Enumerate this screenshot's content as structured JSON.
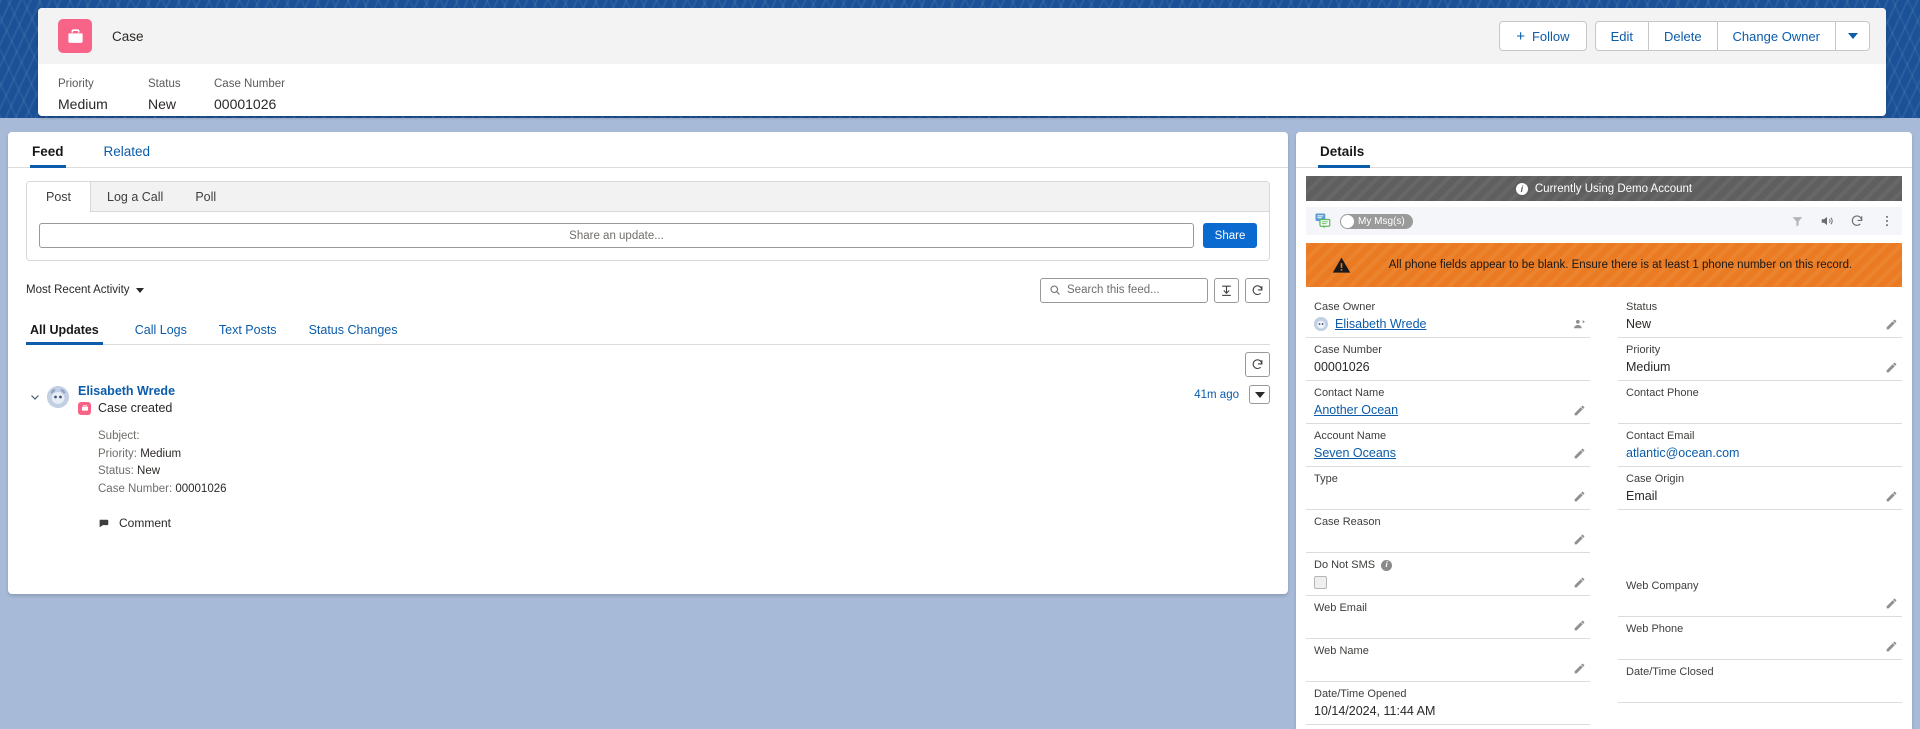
{
  "header": {
    "object_icon": "briefcase-icon",
    "object_label": "Case",
    "fields": [
      {
        "label": "Priority",
        "value": "Medium"
      },
      {
        "label": "Status",
        "value": "New"
      },
      {
        "label": "Case Number",
        "value": "00001026"
      }
    ],
    "actions": {
      "follow": "Follow",
      "edit": "Edit",
      "delete": "Delete",
      "change_owner": "Change Owner"
    }
  },
  "feed": {
    "tabs": [
      {
        "label": "Feed",
        "active": true
      },
      {
        "label": "Related",
        "active": false
      }
    ],
    "publisher": {
      "tabs": [
        {
          "label": "Post",
          "active": true
        },
        {
          "label": "Log a Call",
          "active": false
        },
        {
          "label": "Poll",
          "active": false
        }
      ],
      "input_placeholder": "Share an update...",
      "share_label": "Share"
    },
    "controls": {
      "sort_label": "Most Recent Activity",
      "search_placeholder": "Search this feed...",
      "sort_icon": "sort-icon",
      "refresh_icon": "refresh-icon"
    },
    "subtabs": [
      {
        "label": "All Updates",
        "active": true
      },
      {
        "label": "Call Logs",
        "active": false
      },
      {
        "label": "Text Posts",
        "active": false
      },
      {
        "label": "Status Changes",
        "active": false
      }
    ],
    "item": {
      "author": "Elisabeth Wrede",
      "action": "Case created",
      "timestamp": "41m ago",
      "detail_lines": [
        {
          "label": "Subject:",
          "value": ""
        },
        {
          "label": "Priority:",
          "value": "Medium"
        },
        {
          "label": "Status:",
          "value": "New"
        },
        {
          "label": "Case Number:",
          "value": "00001026"
        }
      ],
      "comment_label": "Comment"
    }
  },
  "details": {
    "tab_label": "Details",
    "demo_banner": "Currently Using Demo Account",
    "messaging": {
      "toggle_label": "My Msg(s)",
      "icons": [
        "messages-icon",
        "filter-icon",
        "volume-icon",
        "refresh-icon",
        "overflow-menu-icon"
      ]
    },
    "warning": "All phone fields appear to be blank. Ensure there is at least 1 phone number on this record.",
    "left_fields": [
      {
        "label": "Case Owner",
        "value": "Elisabeth Wrede",
        "type": "owner"
      },
      {
        "label": "Case Number",
        "value": "00001026",
        "type": "text"
      },
      {
        "label": "Contact Name",
        "value": "Another Ocean",
        "type": "link",
        "editable": true
      },
      {
        "label": "Account Name",
        "value": "Seven Oceans",
        "type": "link",
        "editable": true
      },
      {
        "label": "Type",
        "value": "",
        "type": "text",
        "editable": true
      },
      {
        "label": "Case Reason",
        "value": "",
        "type": "text",
        "editable": true
      },
      {
        "label": "Do Not SMS",
        "value": "",
        "type": "checkbox",
        "editable": true,
        "has_info": true
      },
      {
        "label": "Web Email",
        "value": "",
        "type": "text",
        "editable": true
      },
      {
        "label": "Web Name",
        "value": "",
        "type": "text",
        "editable": true
      },
      {
        "label": "Date/Time Opened",
        "value": "10/14/2024, 11:44 AM",
        "type": "text"
      }
    ],
    "right_fields": [
      {
        "label": "Status",
        "value": "New",
        "type": "text",
        "editable": true
      },
      {
        "label": "Priority",
        "value": "Medium",
        "type": "text",
        "editable": true
      },
      {
        "label": "Contact Phone",
        "value": "",
        "type": "text"
      },
      {
        "label": "Contact Email",
        "value": "atlantic@ocean.com",
        "type": "link-plain"
      },
      {
        "label": "Case Origin",
        "value": "Email",
        "type": "text",
        "editable": true
      },
      {
        "label": "",
        "value": "",
        "type": "spacer"
      },
      {
        "label": "",
        "value": "",
        "type": "spacer"
      },
      {
        "label": "Web Company",
        "value": "",
        "type": "text",
        "editable": true
      },
      {
        "label": "Web Phone",
        "value": "",
        "type": "text",
        "editable": true
      },
      {
        "label": "Date/Time Closed",
        "value": "",
        "type": "text"
      }
    ]
  },
  "colors": {
    "brand_blue": "#0b5cab",
    "case_pink": "#f76488",
    "warning_orange": "#eb7b22",
    "demo_gray": "#5f5f5f",
    "page_bg": "#a7bad8"
  }
}
